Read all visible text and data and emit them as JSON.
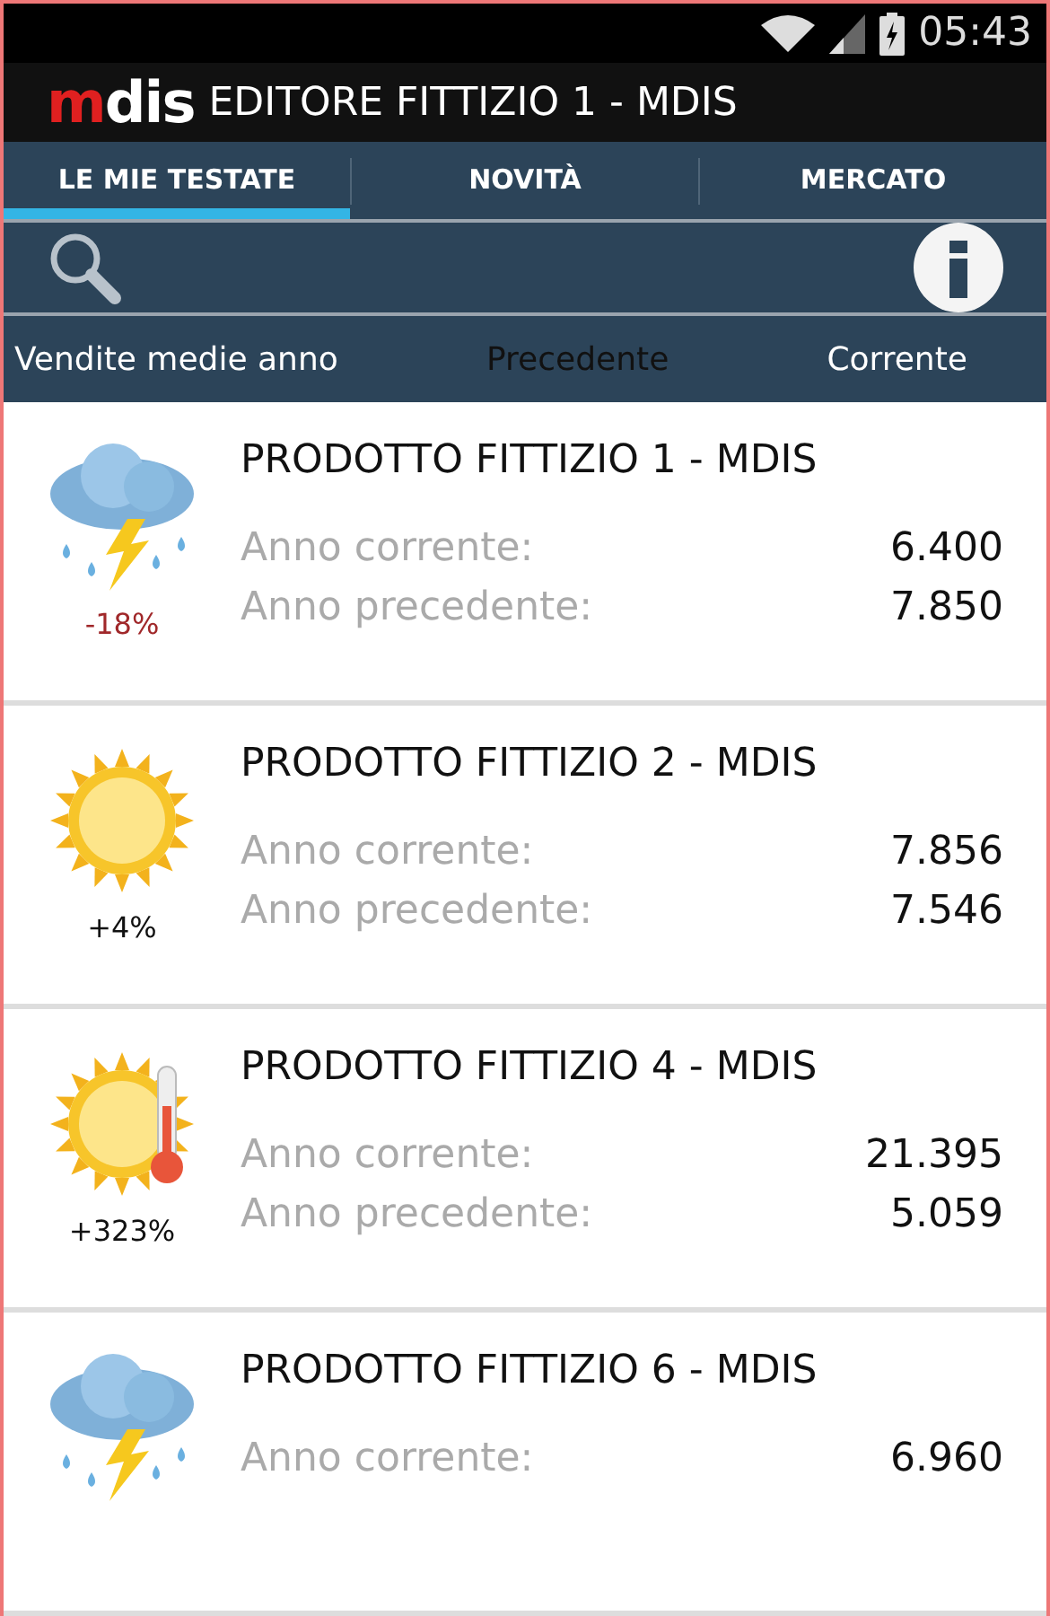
{
  "status_bar": {
    "time": "05:43"
  },
  "app_bar": {
    "logo_left": "m",
    "logo_right": "dis",
    "title": "EDITORE FITTIZIO 1 - MDIS"
  },
  "tabs": [
    {
      "label": "LE MIE TESTATE",
      "selected": true
    },
    {
      "label": "NOVITÀ",
      "selected": false
    },
    {
      "label": "MERCATO",
      "selected": false
    }
  ],
  "columns": [
    {
      "label": "Vendite medie anno",
      "dim": false
    },
    {
      "label": "Precedente",
      "dim": true
    },
    {
      "label": "Corrente",
      "dim": false
    }
  ],
  "products": [
    {
      "kind": "storm",
      "title": "PRODOTTO FITTIZIO 1 - MDIS",
      "change": "-18%",
      "color": "#a0282a",
      "rows": [
        {
          "label": "Anno corrente:",
          "value": "6.400"
        },
        {
          "label": "Anno precedente:",
          "value": "7.850"
        }
      ]
    },
    {
      "kind": "sun",
      "title": "PRODOTTO FITTIZIO 2 - MDIS",
      "change": "+4%",
      "color": "#111111",
      "rows": [
        {
          "label": "Anno corrente:",
          "value": "7.856"
        },
        {
          "label": "Anno precedente:",
          "value": "7.546"
        }
      ]
    },
    {
      "kind": "hot",
      "title": "PRODOTTO FITTIZIO 4 - MDIS",
      "change": "+323%",
      "color": "#111111",
      "rows": [
        {
          "label": "Anno corrente:",
          "value": "21.395"
        },
        {
          "label": "Anno precedente:",
          "value": "5.059"
        }
      ]
    },
    {
      "kind": "storm",
      "title": "PRODOTTO FITTIZIO 6 - MDIS",
      "rows": [
        {
          "label": "Anno corrente:",
          "value": "6.960"
        }
      ]
    }
  ]
}
